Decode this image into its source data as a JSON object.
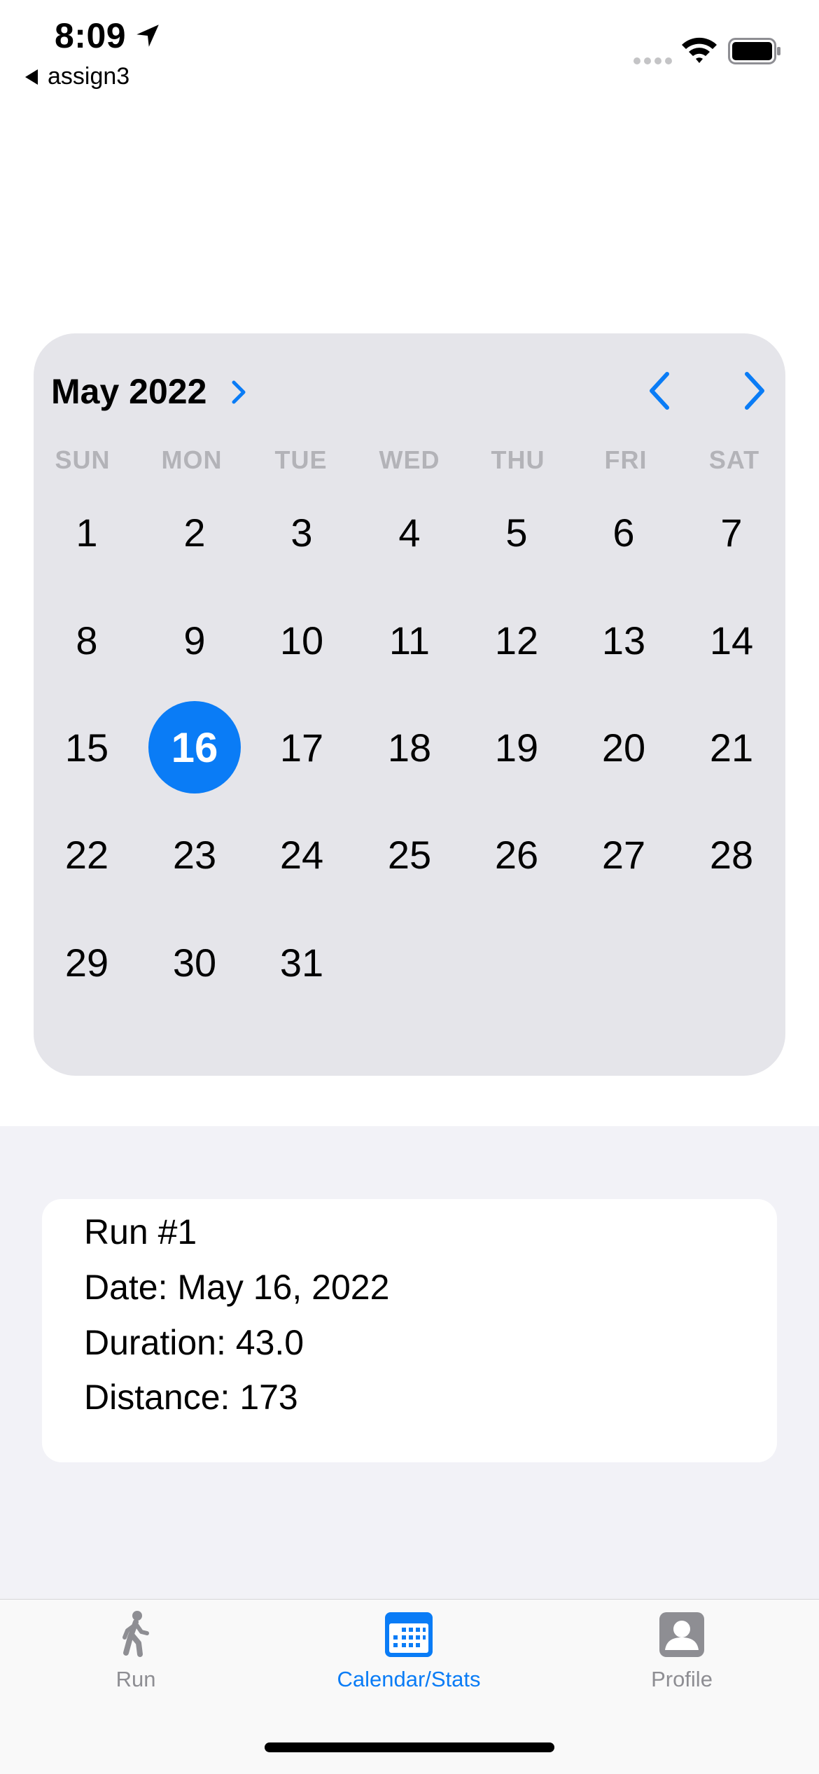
{
  "status_bar": {
    "time": "8:09",
    "back_app": "assign3"
  },
  "calendar": {
    "month_year": "May 2022",
    "weekdays": [
      "SUN",
      "MON",
      "TUE",
      "WED",
      "THU",
      "FRI",
      "SAT"
    ],
    "days": [
      "1",
      "2",
      "3",
      "4",
      "5",
      "6",
      "7",
      "8",
      "9",
      "10",
      "11",
      "12",
      "13",
      "14",
      "15",
      "16",
      "17",
      "18",
      "19",
      "20",
      "21",
      "22",
      "23",
      "24",
      "25",
      "26",
      "27",
      "28",
      "29",
      "30",
      "31"
    ],
    "selected_day": "16",
    "accent_color": "#0a7cf6"
  },
  "run": {
    "title": "Run #1",
    "date": "Date: May 16, 2022",
    "duration": "Duration: 43.0",
    "distance": "Distance: 173"
  },
  "tabs": [
    {
      "label": "Run",
      "icon": "walking-figure-icon",
      "active": false
    },
    {
      "label": "Calendar/Stats",
      "icon": "calendar-icon",
      "active": true
    },
    {
      "label": "Profile",
      "icon": "person-icon",
      "active": false
    }
  ]
}
